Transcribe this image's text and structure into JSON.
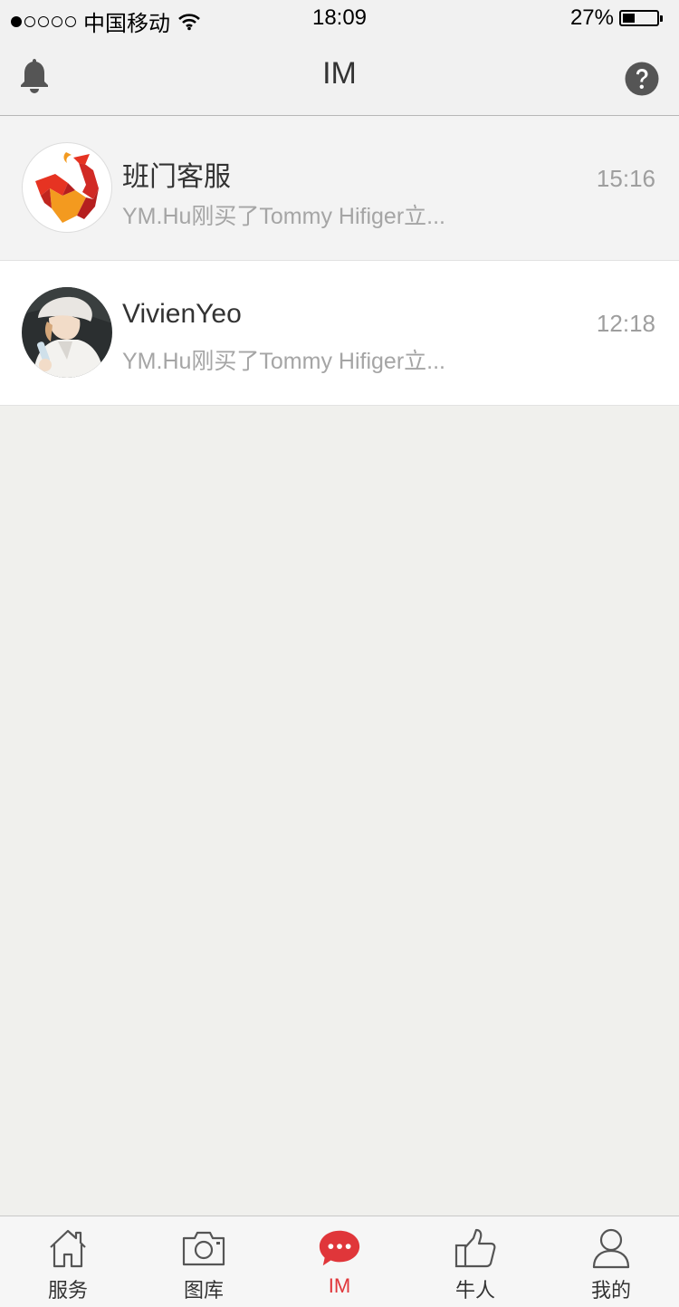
{
  "status_bar": {
    "carrier": "中国移动",
    "time": "18:09",
    "battery": "27%",
    "battery_level": 0.27
  },
  "header": {
    "title": "IM",
    "left_icon": "bell-icon",
    "right_icon": "help-icon"
  },
  "conversations": [
    {
      "name": "班门客服",
      "preview": "YM.Hu刚买了Tommy Hifiger立...",
      "time": "15:16",
      "avatar": "brand-logo-avatar"
    },
    {
      "name": "VivienYeo",
      "preview": "YM.Hu刚买了Tommy Hifiger立...",
      "time": "12:18",
      "avatar": "user-photo-avatar"
    }
  ],
  "tabbar": {
    "items": [
      {
        "label": "服务",
        "icon": "home-icon",
        "active": false
      },
      {
        "label": "图库",
        "icon": "camera-icon",
        "active": false
      },
      {
        "label": "IM",
        "icon": "chat-bubble-icon",
        "active": true
      },
      {
        "label": "牛人",
        "icon": "thumbs-up-icon",
        "active": false
      },
      {
        "label": "我的",
        "icon": "person-icon",
        "active": false
      }
    ]
  },
  "colors": {
    "accent": "#e0363a",
    "background": "#f0f0ed",
    "secondary_text": "#a5a5a5"
  }
}
